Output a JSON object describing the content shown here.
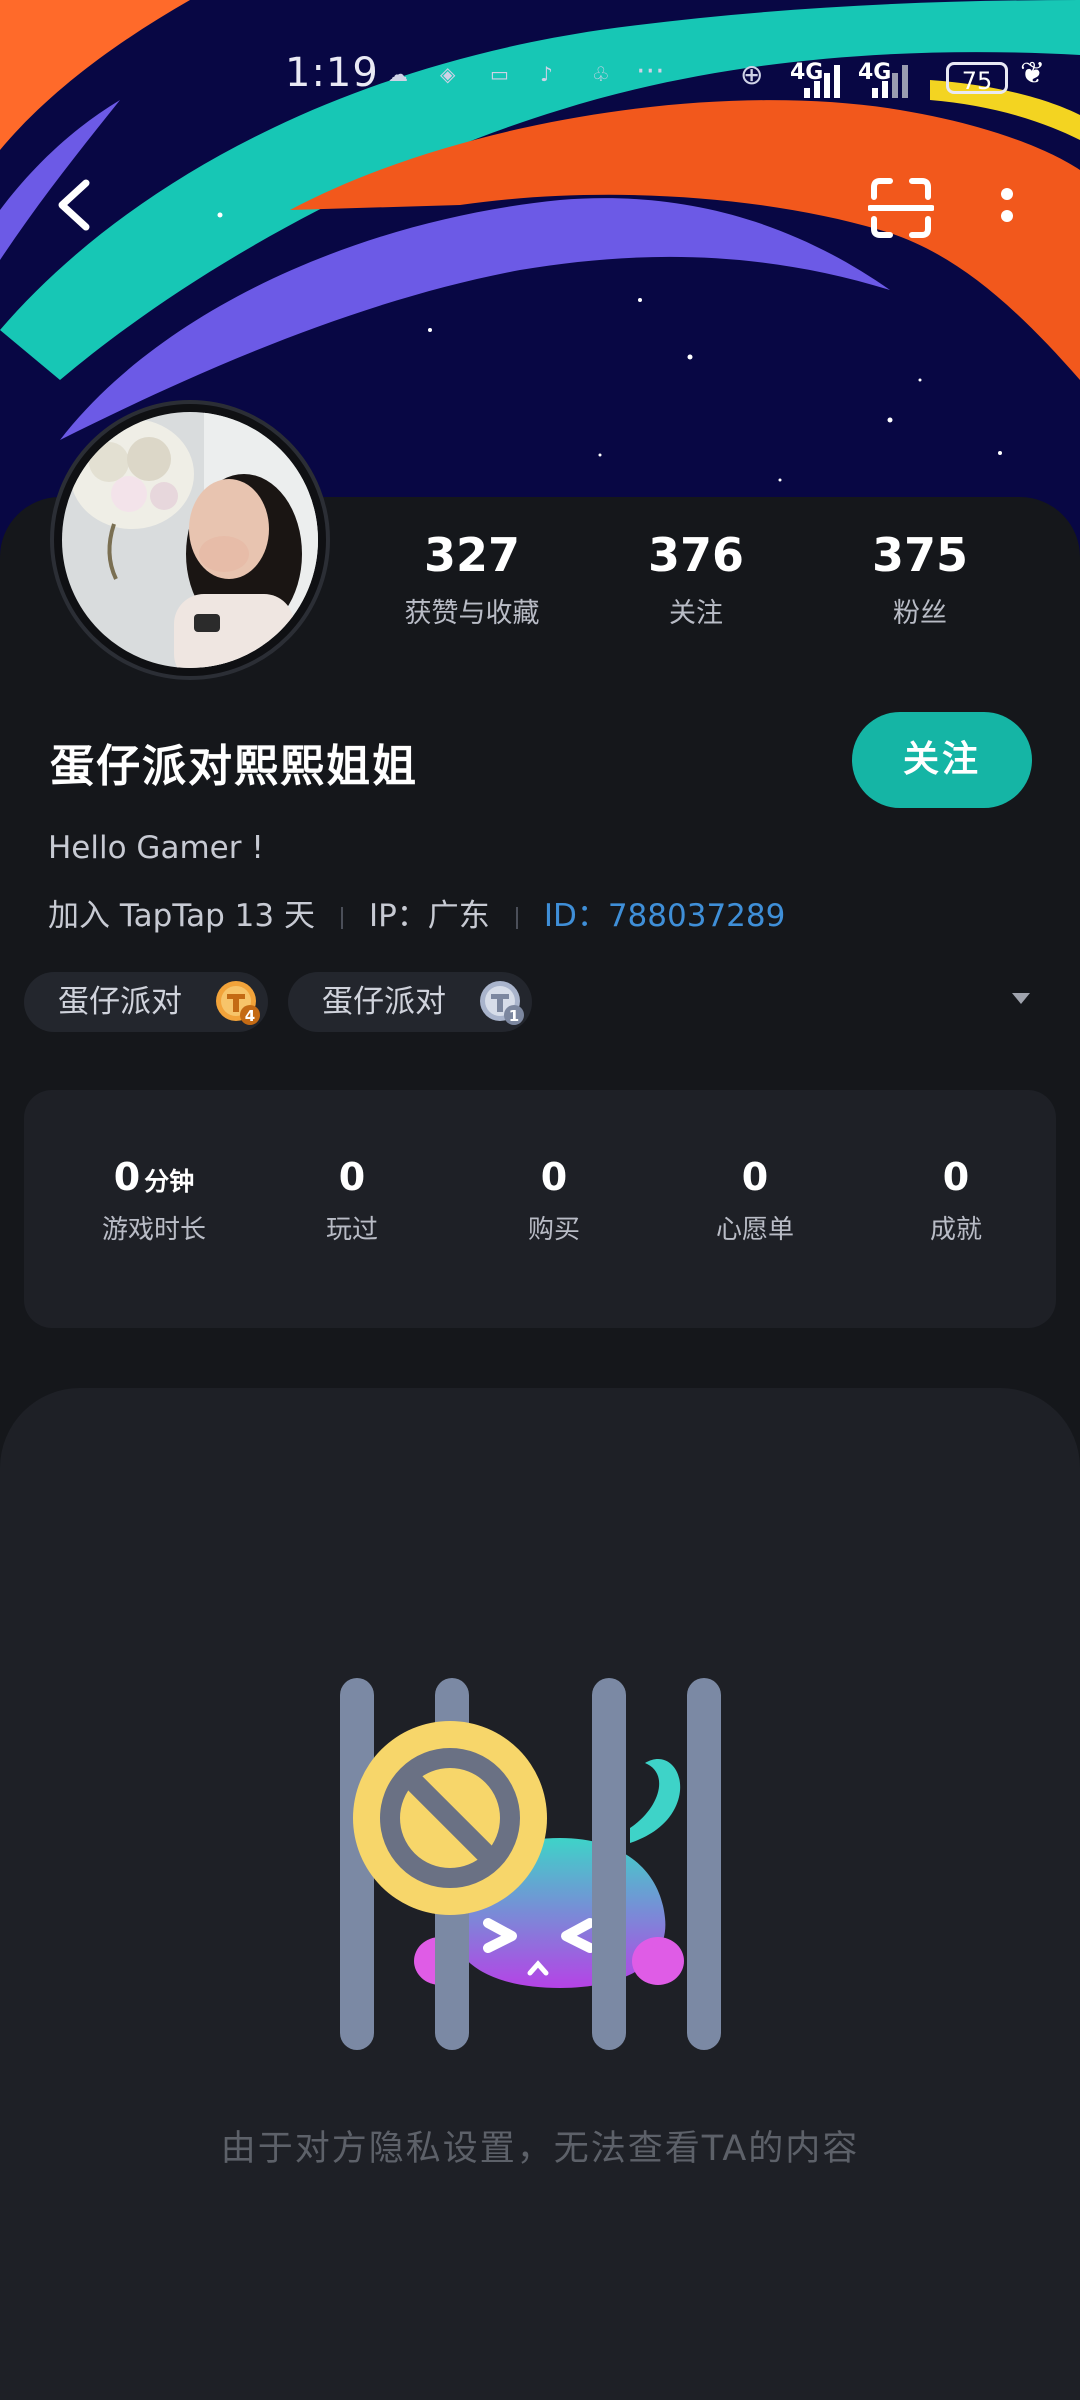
{
  "status_bar": {
    "time": "1:19",
    "network_1": "4G",
    "network_2": "4G",
    "battery": "75"
  },
  "profile": {
    "nickname": "蛋仔派对熙熙姐姐",
    "bio": "Hello Gamer !",
    "joined": "加入 TapTap 13 天",
    "ip": "IP：广东",
    "id_label": "ID：",
    "id_value": "788037289",
    "follow_label": "关注",
    "stats": [
      {
        "value": "327",
        "label": "获赞与收藏"
      },
      {
        "value": "376",
        "label": "关注"
      },
      {
        "value": "375",
        "label": "粉丝"
      }
    ],
    "badges": [
      {
        "name": "蛋仔派对",
        "level": "4"
      },
      {
        "name": "蛋仔派对",
        "level": "1"
      }
    ]
  },
  "game_stats": [
    {
      "value": "0",
      "unit": "分钟",
      "label": "游戏时长"
    },
    {
      "value": "0",
      "unit": "",
      "label": "玩过"
    },
    {
      "value": "0",
      "unit": "",
      "label": "购买"
    },
    {
      "value": "0",
      "unit": "",
      "label": "心愿单"
    },
    {
      "value": "0",
      "unit": "",
      "label": "成就"
    }
  ],
  "privacy_message": "由于对方隐私设置，无法查看TA的内容",
  "colors": {
    "accent": "#15b5a5",
    "link": "#3f8fd8",
    "background": "#15171b",
    "panel": "#1e2026"
  }
}
